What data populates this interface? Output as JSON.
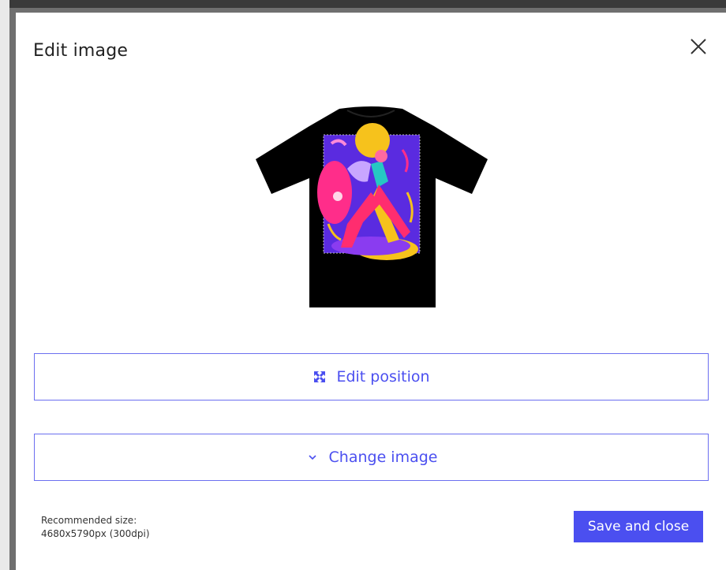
{
  "modal": {
    "title": "Edit image",
    "edit_position_label": "Edit position",
    "change_image_label": "Change image",
    "recommended_label": "Recommended size:",
    "recommended_value": "4680x5790px (300dpi)",
    "save_label": "Save and close"
  },
  "colors": {
    "accent": "#4b4ff0",
    "tshirt": "#000000"
  },
  "icons": {
    "close": "close-icon",
    "edit_position": "move-arrows-icon",
    "change_image": "chevron-down-icon"
  }
}
